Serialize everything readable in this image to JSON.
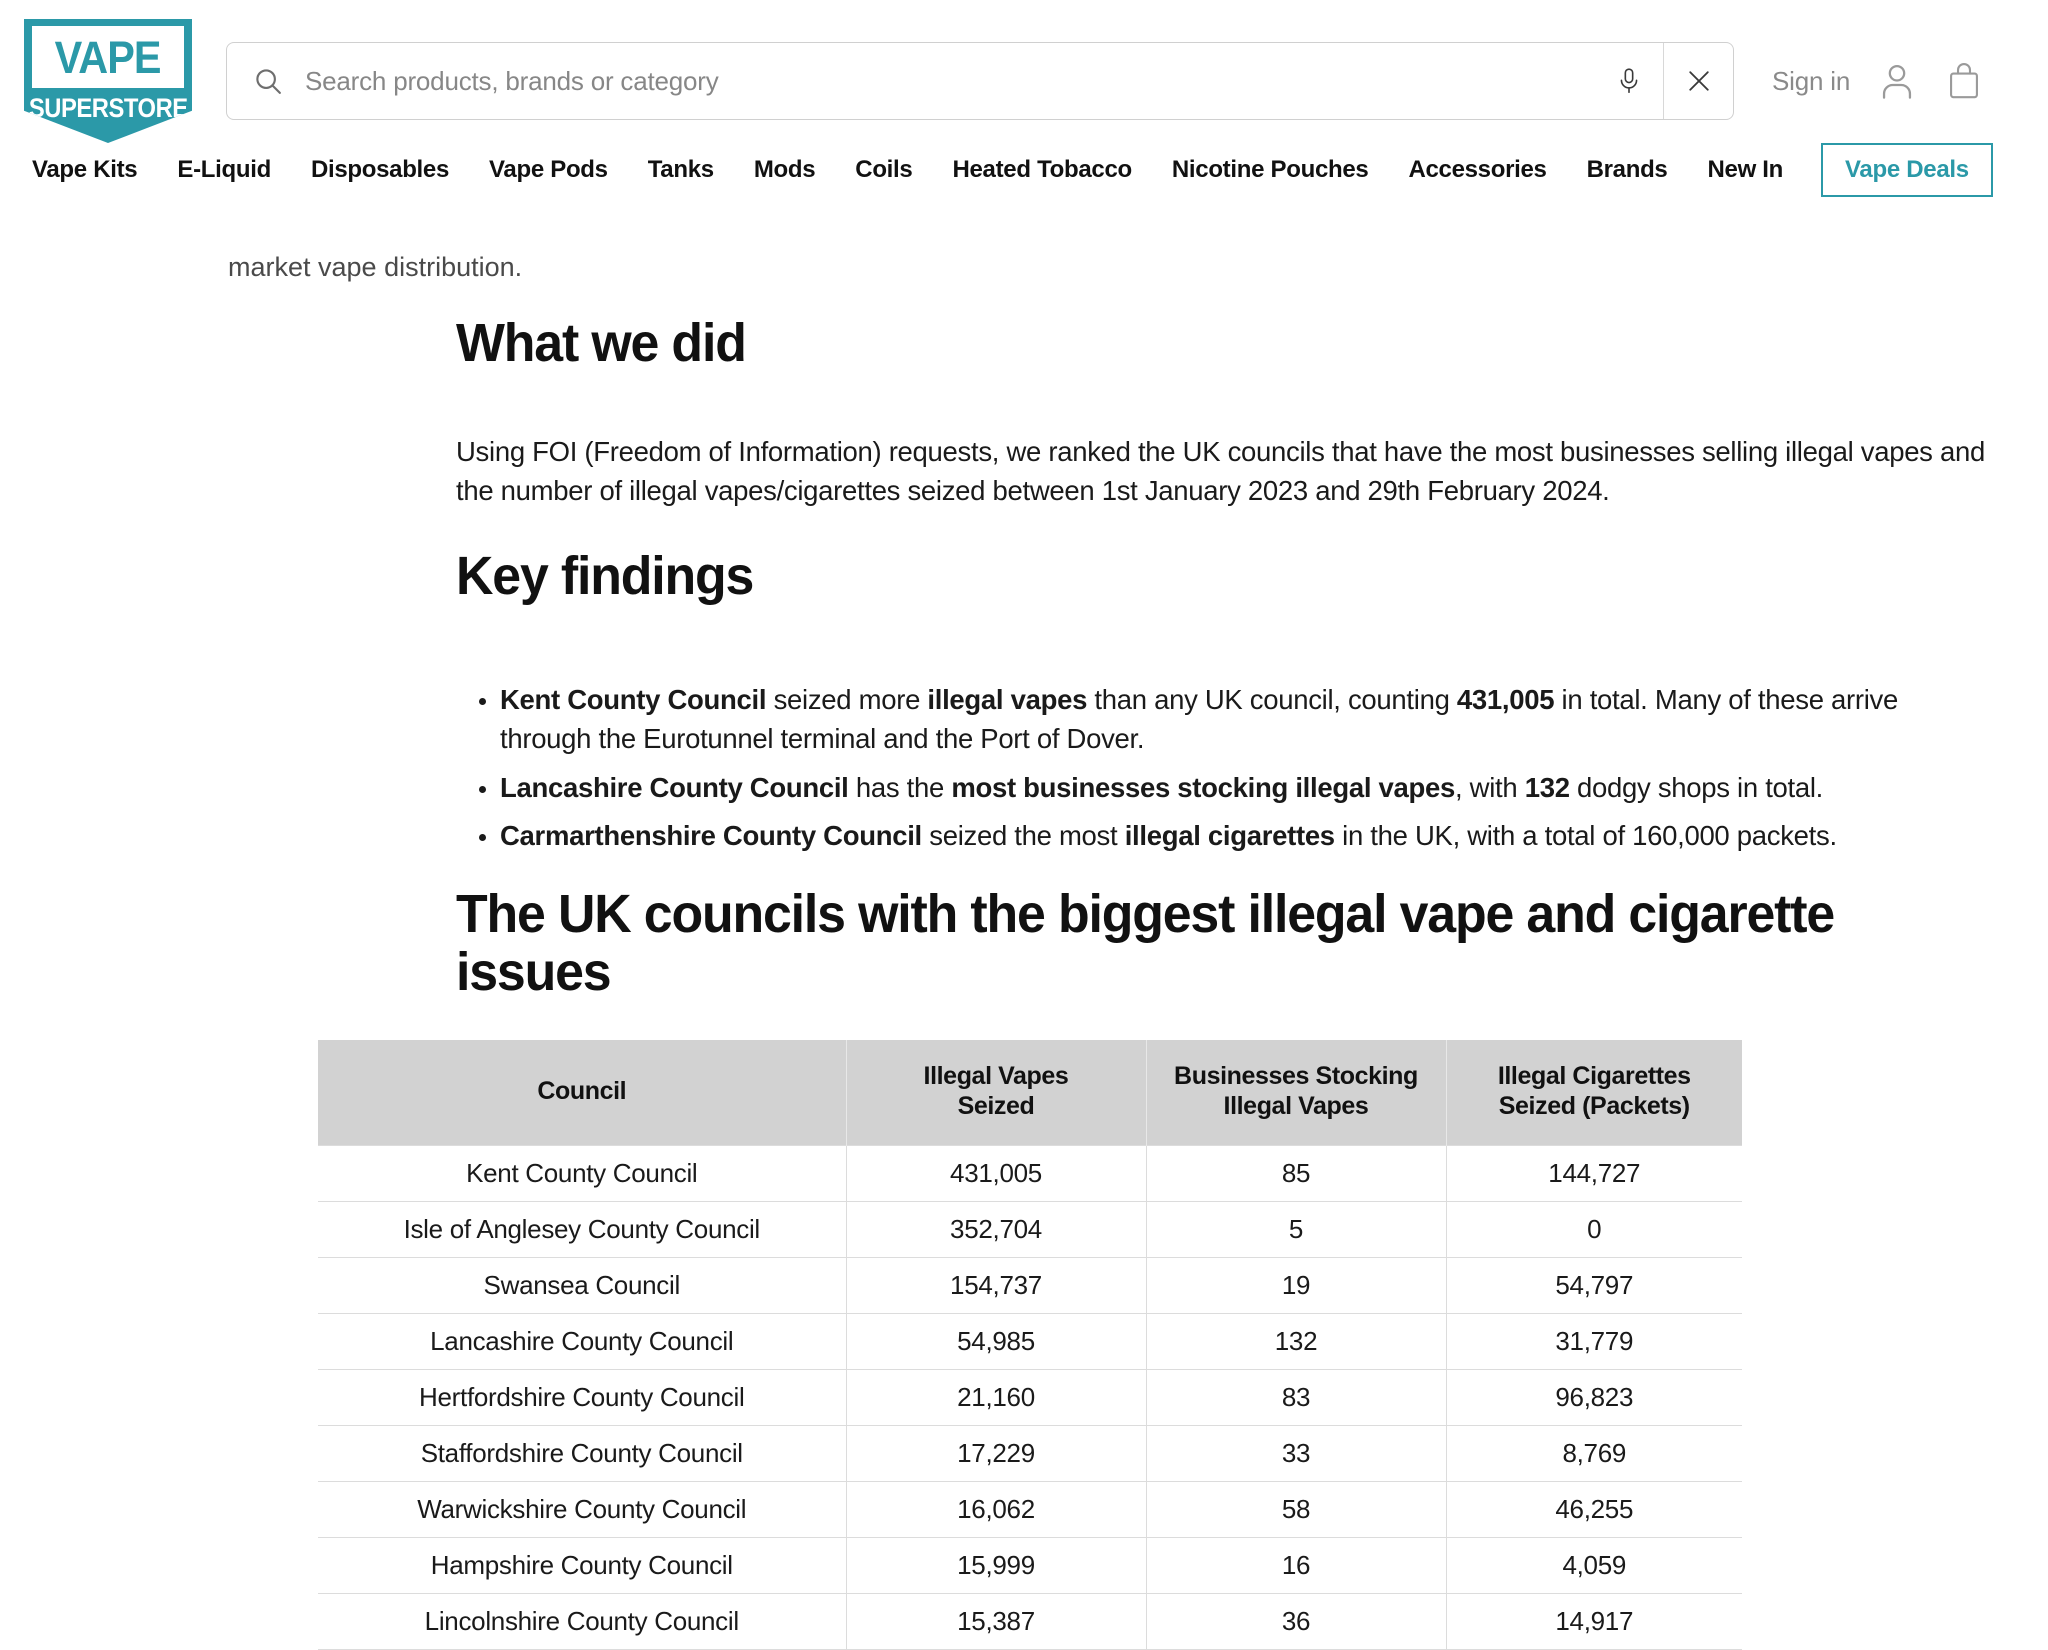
{
  "brand": {
    "logo_top": "VAPE",
    "logo_bottom": "SUPERSTORE",
    "teal": "#2B99A8"
  },
  "search": {
    "placeholder": "Search products, brands or category",
    "value": "",
    "search_icon": "search-icon",
    "mic_icon": "microphone-icon",
    "clear_icon": "close-icon"
  },
  "account": {
    "signin_label": "Sign in",
    "user_icon": "user-icon",
    "bag_icon": "shopping-bag-icon"
  },
  "nav": {
    "items": [
      {
        "label": "Vape Kits"
      },
      {
        "label": "E-Liquid"
      },
      {
        "label": "Disposables"
      },
      {
        "label": "Vape Pods"
      },
      {
        "label": "Tanks"
      },
      {
        "label": "Mods"
      },
      {
        "label": "Coils"
      },
      {
        "label": "Heated Tobacco"
      },
      {
        "label": "Nicotine Pouches"
      },
      {
        "label": "Accessories"
      },
      {
        "label": "Brands"
      },
      {
        "label": "New In"
      }
    ],
    "deals_label": "Vape Deals"
  },
  "article": {
    "clipped_line": "market vape distribution.",
    "what_we_did_title": "What we did",
    "what_we_did_body_1": "Using FOI (Freedom of Information) requests, we ranked the UK councils that have the most businesses selling illegal",
    "what_we_did_body_2": "vapes and the number of illegal vapes/cigarettes seized between 1st January 2023 and 29th February 2024.",
    "key_findings_title": "Key findings",
    "findings": [
      {
        "p1_bold": "Kent County Council",
        "p2": " seized more ",
        "p3_bold": "illegal vapes",
        "p4": " than any UK council, counting ",
        "p5_bold": "431,005",
        "p6": " in total. Many of these arrive through the Eurotunnel terminal and the Port of Dover."
      },
      {
        "p1_bold": "Lancashire County Council",
        "p2": " has the ",
        "p3_bold": "most businesses stocking illegal vapes",
        "p4": ", with ",
        "p5_bold": "132",
        "p6": " dodgy shops in total."
      },
      {
        "p1_bold": "Carmarthenshire County Council",
        "p2": " seized the most ",
        "p3_bold": "illegal cigarettes",
        "p4": " in the UK, with a total of 160,000 packets.",
        "p5_bold": "",
        "p6": ""
      }
    ],
    "table_title": "The UK councils with the biggest illegal vape and cigarette issues"
  },
  "chart_data": {
    "type": "table",
    "title": "The UK councils with the biggest illegal vape and cigarette issues",
    "columns": [
      "Council",
      "Illegal Vapes Seized",
      "Businesses Stocking Illegal Vapes",
      "Illegal Cigarettes Seized (Packets)"
    ],
    "column_labels_wrapped": [
      [
        "Council"
      ],
      [
        "Illegal Vapes",
        "Seized"
      ],
      [
        "Businesses Stocking",
        "Illegal Vapes"
      ],
      [
        "Illegal Cigarettes",
        "Seized (Packets)"
      ]
    ],
    "rows": [
      {
        "council": "Kent County Council",
        "illegal_vapes_seized": "431,005",
        "businesses_stocking": "85",
        "illegal_cigarettes_packets": "144,727"
      },
      {
        "council": "Isle of Anglesey County Council",
        "illegal_vapes_seized": "352,704",
        "businesses_stocking": "5",
        "illegal_cigarettes_packets": "0"
      },
      {
        "council": "Swansea Council",
        "illegal_vapes_seized": "154,737",
        "businesses_stocking": "19",
        "illegal_cigarettes_packets": "54,797"
      },
      {
        "council": "Lancashire County Council",
        "illegal_vapes_seized": "54,985",
        "businesses_stocking": "132",
        "illegal_cigarettes_packets": "31,779"
      },
      {
        "council": "Hertfordshire County Council",
        "illegal_vapes_seized": "21,160",
        "businesses_stocking": "83",
        "illegal_cigarettes_packets": "96,823"
      },
      {
        "council": "Staffordshire County Council",
        "illegal_vapes_seized": "17,229",
        "businesses_stocking": "33",
        "illegal_cigarettes_packets": "8,769"
      },
      {
        "council": "Warwickshire County Council",
        "illegal_vapes_seized": "16,062",
        "businesses_stocking": "58",
        "illegal_cigarettes_packets": "46,255"
      },
      {
        "council": "Hampshire County Council",
        "illegal_vapes_seized": "15,999",
        "businesses_stocking": "16",
        "illegal_cigarettes_packets": "4,059"
      },
      {
        "council": "Lincolnshire County Council",
        "illegal_vapes_seized": "15,387",
        "businesses_stocking": "36",
        "illegal_cigarettes_packets": "14,917"
      }
    ]
  }
}
